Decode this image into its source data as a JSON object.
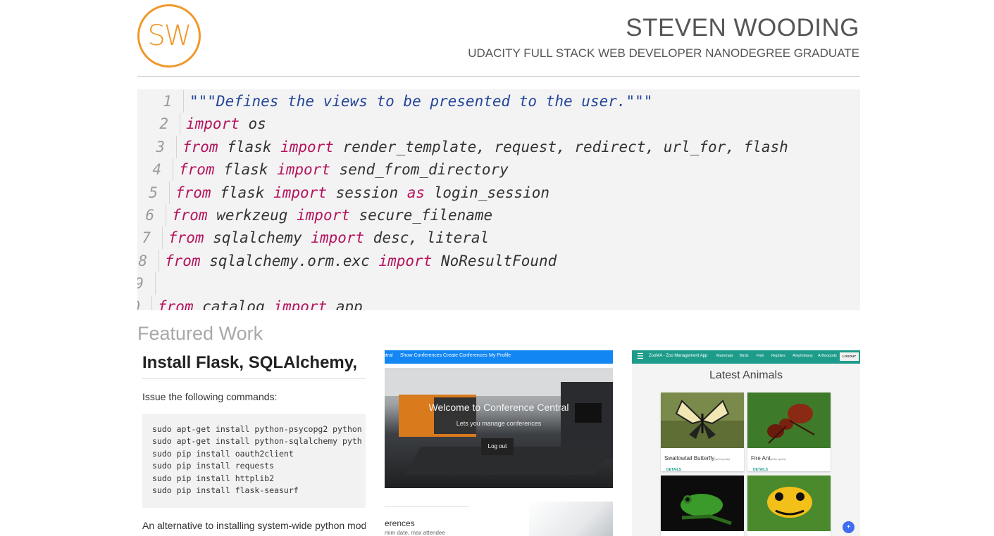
{
  "header": {
    "logo_text": "SW",
    "name": "STEVEN WOODING",
    "tagline": "UDACITY FULL STACK WEB DEVELOPER NANODEGREE GRADUATE",
    "logo_color": "#f0982b"
  },
  "code": {
    "keyword_color": "#b5135e",
    "string_color": "#23459b",
    "lines": [
      {
        "num": "1",
        "tokens": [
          {
            "t": "\"\"\"Defines the views to be presented to the user.\"\"\"",
            "c": "str"
          }
        ]
      },
      {
        "num": "2",
        "tokens": [
          {
            "t": "import",
            "c": "kw"
          },
          {
            "t": " os",
            "c": ""
          }
        ]
      },
      {
        "num": "3",
        "tokens": [
          {
            "t": "from",
            "c": "kw"
          },
          {
            "t": " flask ",
            "c": ""
          },
          {
            "t": "import",
            "c": "kw"
          },
          {
            "t": " render_template, request, redirect, url_for, flash",
            "c": ""
          }
        ]
      },
      {
        "num": "4",
        "tokens": [
          {
            "t": "from",
            "c": "kw"
          },
          {
            "t": " flask ",
            "c": ""
          },
          {
            "t": "import",
            "c": "kw"
          },
          {
            "t": " send_from_directory",
            "c": ""
          }
        ]
      },
      {
        "num": "5",
        "tokens": [
          {
            "t": "from",
            "c": "kw"
          },
          {
            "t": " flask ",
            "c": ""
          },
          {
            "t": "import",
            "c": "kw"
          },
          {
            "t": " session ",
            "c": ""
          },
          {
            "t": "as",
            "c": "kw"
          },
          {
            "t": " login_session",
            "c": ""
          }
        ]
      },
      {
        "num": "6",
        "tokens": [
          {
            "t": "from",
            "c": "kw"
          },
          {
            "t": " werkzeug ",
            "c": ""
          },
          {
            "t": "import",
            "c": "kw"
          },
          {
            "t": " secure_filename",
            "c": ""
          }
        ]
      },
      {
        "num": "7",
        "tokens": [
          {
            "t": "from",
            "c": "kw"
          },
          {
            "t": " sqlalchemy ",
            "c": ""
          },
          {
            "t": "import",
            "c": "kw"
          },
          {
            "t": " desc, literal",
            "c": ""
          }
        ]
      },
      {
        "num": "8",
        "tokens": [
          {
            "t": "from",
            "c": "kw"
          },
          {
            "t": " sqlalchemy.orm.exc ",
            "c": ""
          },
          {
            "t": "import",
            "c": "kw"
          },
          {
            "t": " NoResultFound",
            "c": ""
          }
        ]
      },
      {
        "num": "9",
        "tokens": []
      },
      {
        "num": "0",
        "tokens": [
          {
            "t": "from",
            "c": "kw"
          },
          {
            "t": " catalog ",
            "c": ""
          },
          {
            "t": "import",
            "c": "kw"
          },
          {
            "t": " app",
            "c": ""
          }
        ]
      }
    ]
  },
  "featured": {
    "title": "Featured Work",
    "card1": {
      "heading": "Install Flask, SQLAlchemy,",
      "intro": "Issue the following commands:",
      "commands": [
        "sudo apt-get install python-psycopg2 python",
        "sudo apt-get install python-sqlalchemy pyth",
        "sudo pip install oauth2client",
        "sudo pip install requests",
        "sudo pip install httplib2",
        "sudo pip install flask-seasurf"
      ],
      "footer": "An alternative to installing system-wide python mod"
    },
    "card2": {
      "nav": [
        "ntral",
        "Show Conferences",
        "Create Conferences",
        "My Profile"
      ],
      "welcome": "Welcome to Conference Central",
      "subtitle": "Lets you manage conferences",
      "logout": "Log out",
      "section": "erences",
      "desc": "mim date, max attendee",
      "nav_color": "#1286f3"
    },
    "card3": {
      "menu_icon": "☰",
      "app_title": "ZooMA - Zoo Management App",
      "nav": [
        "Mammals",
        "Birds",
        "Fish",
        "Reptiles",
        "Amphibians",
        "Arthropods"
      ],
      "logout": "LOGOUT",
      "heading": "Latest Animals",
      "animals": [
        {
          "name": "Swallowtail Butterfly",
          "class": "(Arthropods)",
          "details": "DETAILS"
        },
        {
          "name": "Fire Ant",
          "class": "(Arthropods)",
          "details": "DETAILS"
        },
        {
          "name": "",
          "class": "",
          "details": ""
        },
        {
          "name": "",
          "class": "",
          "details": ""
        }
      ],
      "fab": "+",
      "nav_color": "#1e9c8b"
    }
  }
}
